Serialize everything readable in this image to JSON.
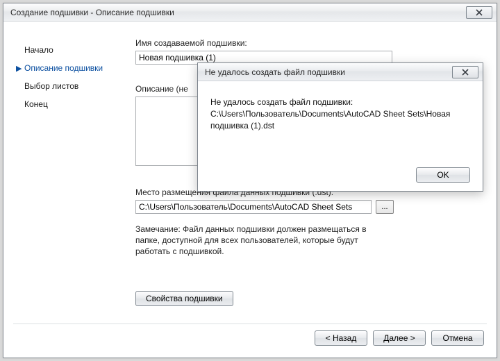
{
  "wizard": {
    "title": "Создание подшивки - Описание подшивки",
    "steps": {
      "begin": "Начало",
      "describe": "Описание подшивки",
      "sheets": "Выбор листов",
      "end": "Конец"
    },
    "name_label": "Имя создаваемой подшивки:",
    "name_value": "Новая подшивка (1)",
    "desc_label": "Описание (не",
    "path_label": "Место размещения файла данных подшивки (.dst):",
    "path_value": "C:\\Users\\Пользователь\\Documents\\AutoCAD Sheet Sets",
    "browse_label": "...",
    "note": "Замечание: Файл данных подшивки должен размещаться в папке, доступной для всех пользователей, которые будут работать с подшивкой.",
    "props_btn": "Свойства подшивки",
    "back": "< Назад",
    "next": "Далее >",
    "cancel": "Отмена"
  },
  "error": {
    "title": "Не удалось создать файл подшивки",
    "line1": "Не удалось создать файл подшивки:",
    "line2": "C:\\Users\\Пользователь\\Documents\\AutoCAD Sheet Sets\\Новая подшивка (1).dst",
    "ok": "OK"
  }
}
